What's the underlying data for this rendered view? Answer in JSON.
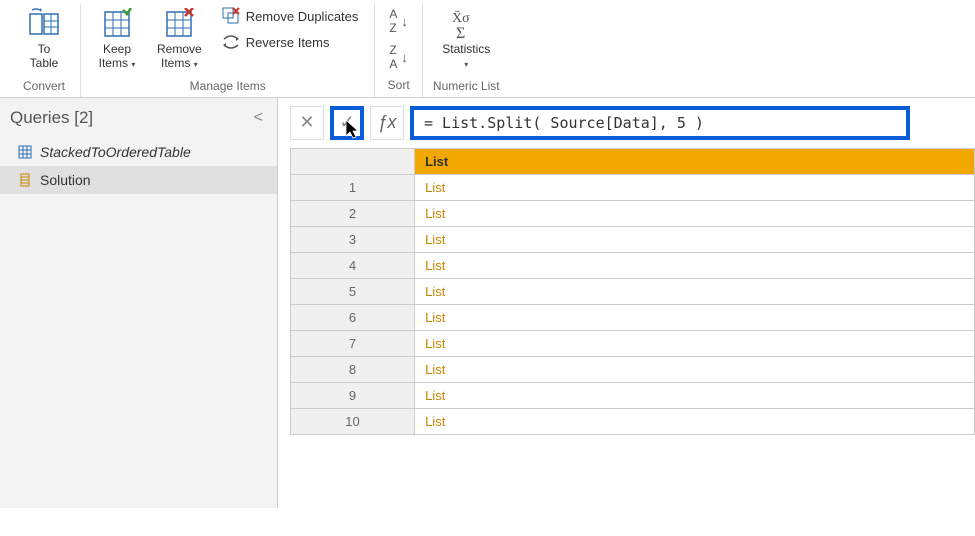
{
  "ribbon": {
    "convert": {
      "to_table": "To\nTable",
      "group_label": "Convert"
    },
    "manage": {
      "keep_items": "Keep\nItems",
      "remove_items": "Remove\nItems",
      "remove_duplicates": "Remove Duplicates",
      "reverse_items": "Reverse Items",
      "group_label": "Manage Items"
    },
    "sort": {
      "group_label": "Sort"
    },
    "numeric": {
      "statistics": "Statistics",
      "group_label": "Numeric List"
    }
  },
  "queries": {
    "header": "Queries [2]",
    "items": [
      {
        "name": "StackedToOrderedTable",
        "italic": true,
        "type": "table"
      },
      {
        "name": "Solution",
        "italic": false,
        "type": "list"
      }
    ]
  },
  "formula": "= List.Split( Source[Data], 5 )",
  "list_preview": {
    "column_header": "List",
    "rows": [
      {
        "n": "1",
        "v": "List"
      },
      {
        "n": "2",
        "v": "List"
      },
      {
        "n": "3",
        "v": "List"
      },
      {
        "n": "4",
        "v": "List"
      },
      {
        "n": "5",
        "v": "List"
      },
      {
        "n": "6",
        "v": "List"
      },
      {
        "n": "7",
        "v": "List"
      },
      {
        "n": "8",
        "v": "List"
      },
      {
        "n": "9",
        "v": "List"
      },
      {
        "n": "10",
        "v": "List"
      }
    ]
  }
}
